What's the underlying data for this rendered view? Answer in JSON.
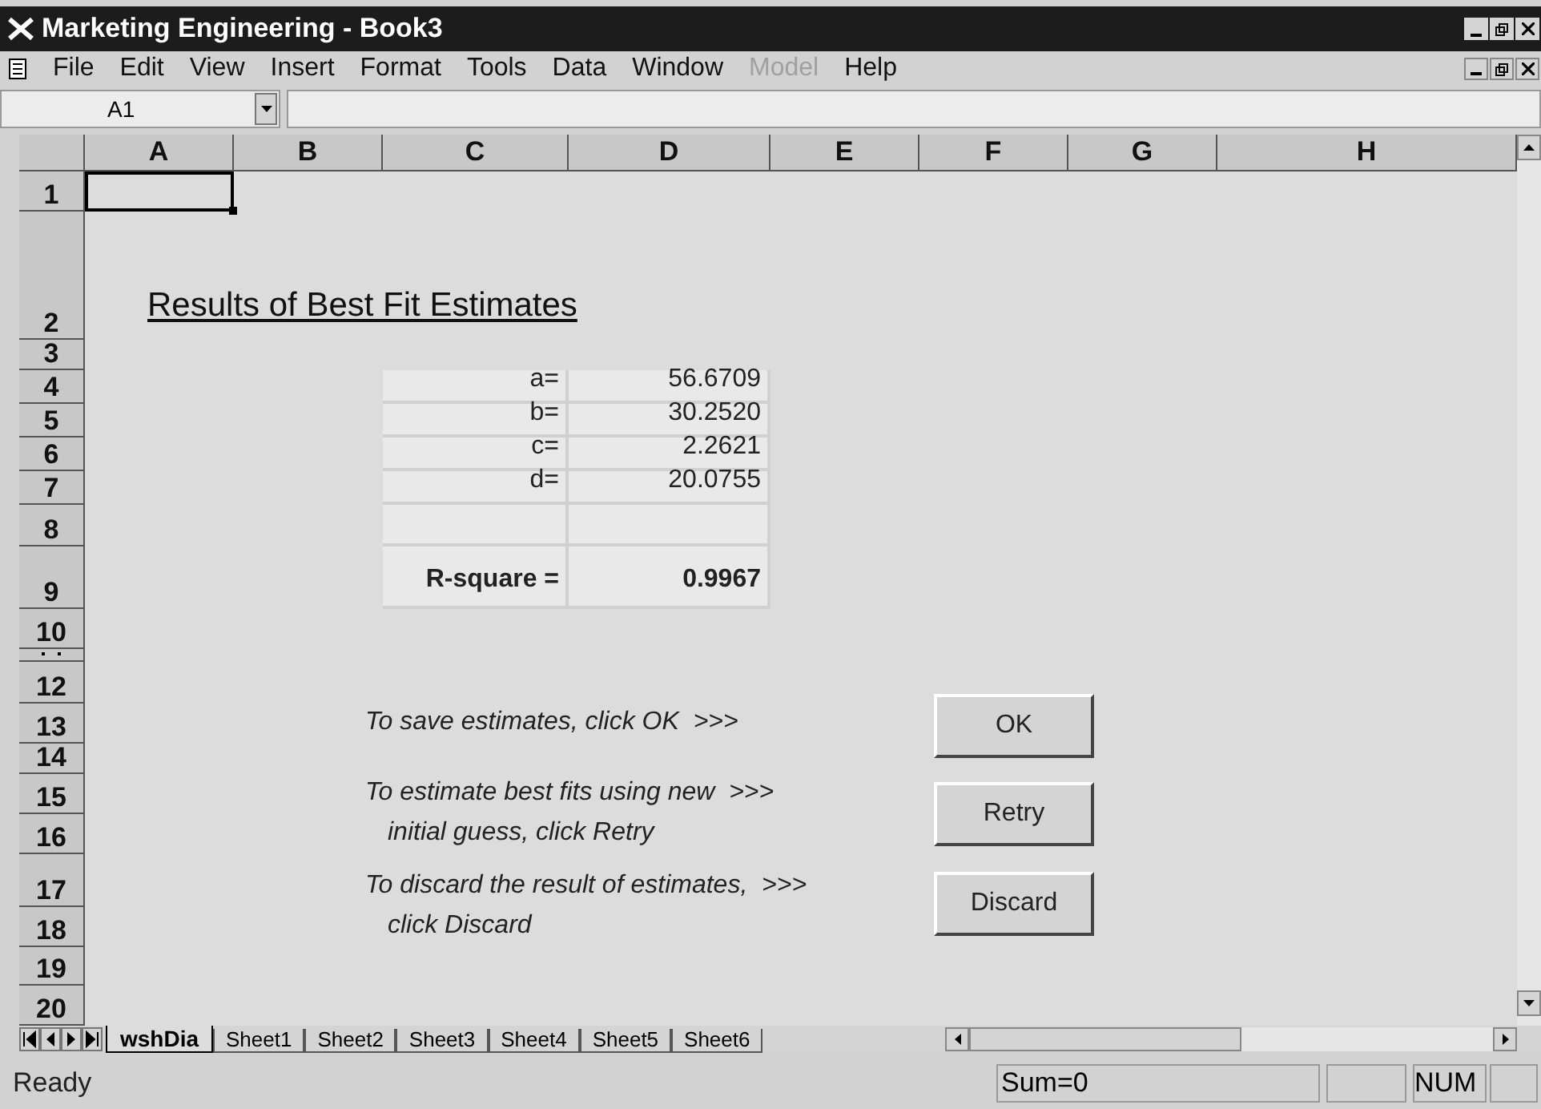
{
  "window": {
    "title": "Marketing Engineering - Book3"
  },
  "menu": [
    {
      "label": "File",
      "disabled": false
    },
    {
      "label": "Edit",
      "disabled": false
    },
    {
      "label": "View",
      "disabled": false
    },
    {
      "label": "Insert",
      "disabled": false
    },
    {
      "label": "Format",
      "disabled": false
    },
    {
      "label": "Tools",
      "disabled": false
    },
    {
      "label": "Data",
      "disabled": false
    },
    {
      "label": "Window",
      "disabled": false
    },
    {
      "label": "Model",
      "disabled": true
    },
    {
      "label": "Help",
      "disabled": false
    }
  ],
  "name_box": "A1",
  "columns": [
    "A",
    "B",
    "C",
    "D",
    "E",
    "F",
    "G",
    "H"
  ],
  "rows": [
    {
      "label": "1"
    },
    {
      "label": "2"
    },
    {
      "label": "3"
    },
    {
      "label": "4"
    },
    {
      "label": "5"
    },
    {
      "label": "6"
    },
    {
      "label": "7"
    },
    {
      "label": "8"
    },
    {
      "label": "9"
    },
    {
      "label": "10"
    },
    {
      "kind": "collapsed"
    },
    {
      "label": "12"
    },
    {
      "label": "13"
    },
    {
      "label": "14"
    },
    {
      "label": "15"
    },
    {
      "label": "16"
    },
    {
      "label": "17"
    },
    {
      "label": "18"
    },
    {
      "label": "19"
    },
    {
      "label": "20"
    }
  ],
  "heading": "Results of Best Fit Estimates",
  "estimates": [
    {
      "kind": "value",
      "label": "a=",
      "value": "56.6709"
    },
    {
      "kind": "value",
      "label": "b=",
      "value": "30.2520"
    },
    {
      "kind": "value",
      "label": "c=",
      "value": "2.2621"
    },
    {
      "kind": "value",
      "label": "d=",
      "value": "20.0755"
    },
    {
      "kind": "blank"
    },
    {
      "kind": "total",
      "label": "R-square =",
      "value": "0.9967"
    }
  ],
  "instructions": [
    {
      "lines": [
        "To save estimates, click OK  >>>"
      ]
    },
    {
      "lines": [
        "To estimate best fits using new  >>>",
        "initial guess, click Retry"
      ]
    },
    {
      "lines": [
        "To discard the result of estimates,  >>>",
        "click Discard"
      ]
    }
  ],
  "buttons": [
    "OK",
    "Retry",
    "Discard"
  ],
  "sheet_tabs": [
    {
      "label": "wshDia",
      "selected": true
    },
    {
      "label": "Sheet1",
      "selected": false
    },
    {
      "label": "Sheet2",
      "selected": false
    },
    {
      "label": "Sheet3",
      "selected": false
    },
    {
      "label": "Sheet4",
      "selected": false
    },
    {
      "label": "Sheet5",
      "selected": false
    },
    {
      "label": "Sheet6",
      "selected": false
    }
  ],
  "status_bar": {
    "text": "Ready",
    "sum": "Sum=0",
    "num": "NUM"
  }
}
